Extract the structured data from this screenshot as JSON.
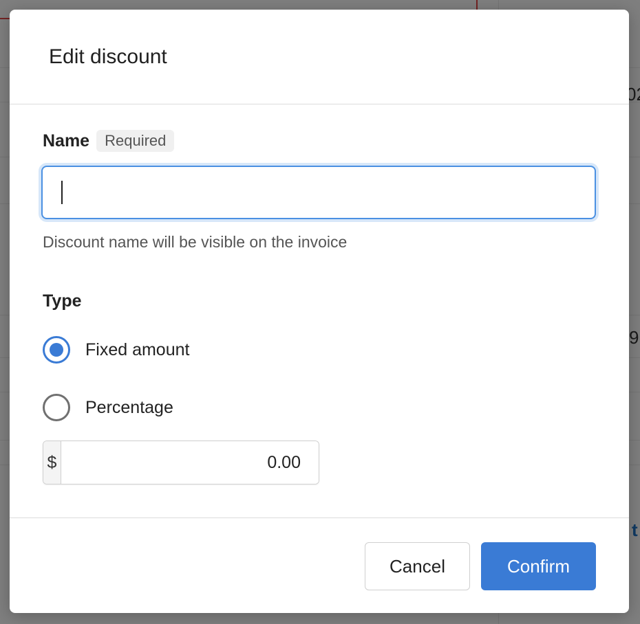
{
  "background": {
    "fragments": [
      "02",
      "9",
      "t"
    ]
  },
  "modal": {
    "title": "Edit discount",
    "name_field": {
      "label": "Name",
      "badge": "Required",
      "value": "",
      "placeholder": "",
      "helper": "Discount name will be visible on the invoice"
    },
    "type_field": {
      "label": "Type",
      "options": [
        {
          "label": "Fixed amount",
          "checked": true
        },
        {
          "label": "Percentage",
          "checked": false
        }
      ]
    },
    "amount_field": {
      "currency_symbol": "$",
      "value": "0.00"
    },
    "footer": {
      "cancel_label": "Cancel",
      "confirm_label": "Confirm"
    }
  },
  "colors": {
    "accent": "#3a7bd5",
    "focus_ring": "#4a90e2"
  }
}
